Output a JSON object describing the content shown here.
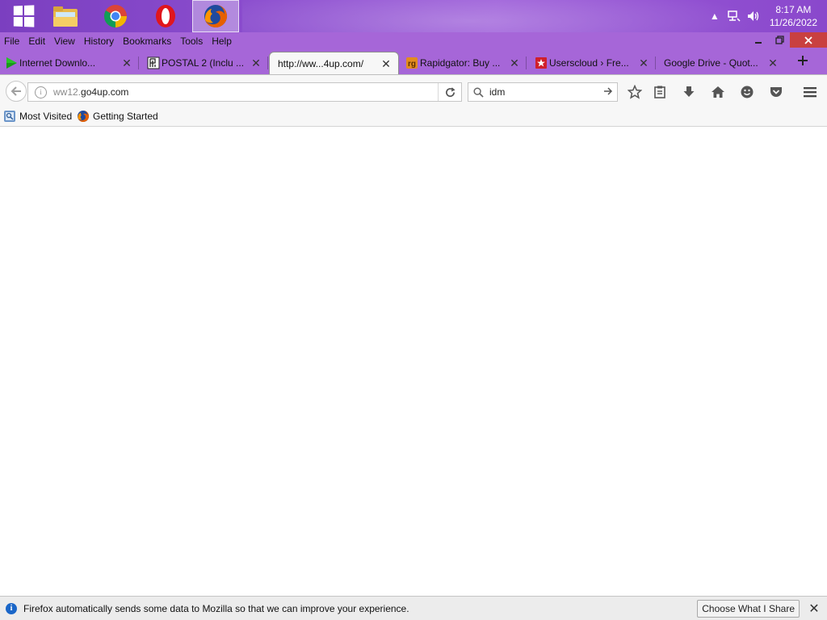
{
  "taskbar": {
    "apps": [
      {
        "name": "start-button"
      },
      {
        "name": "file-explorer"
      },
      {
        "name": "chrome"
      },
      {
        "name": "opera"
      },
      {
        "name": "firefox",
        "active": true
      }
    ],
    "clock": {
      "time": "8:17 AM",
      "date": "11/26/2022"
    }
  },
  "menubar": {
    "items": [
      "File",
      "Edit",
      "View",
      "History",
      "Bookmarks",
      "Tools",
      "Help"
    ]
  },
  "tabs": [
    {
      "label": "Internet Downlo...",
      "icon": "idm-play-icon"
    },
    {
      "label": "POSTAL 2 (Inclu ...",
      "icon": "postal-icon"
    },
    {
      "label": "http://ww...4up.com/",
      "icon": "none",
      "active": true
    },
    {
      "label": "Rapidgator: Buy ...",
      "icon": "rapidgator-icon"
    },
    {
      "label": "Userscloud › Fre...",
      "icon": "userscloud-star-icon"
    },
    {
      "label": "Google Drive - Quot...",
      "icon": "none"
    }
  ],
  "navbar": {
    "url_prefix": "ww12.",
    "url_domain": "go4up.com",
    "search_value": "idm"
  },
  "bookmarks": {
    "items": [
      "Most Visited",
      "Getting Started"
    ]
  },
  "notification": {
    "text": "Firefox automatically sends some data to Mozilla so that we can improve your experience.",
    "button": "Choose What I Share"
  },
  "colors": {
    "taskbar": "#8d4fd0",
    "firefox_chrome": "#a666d8",
    "close_button": "#c94040",
    "info_blue": "#1a66c8"
  }
}
